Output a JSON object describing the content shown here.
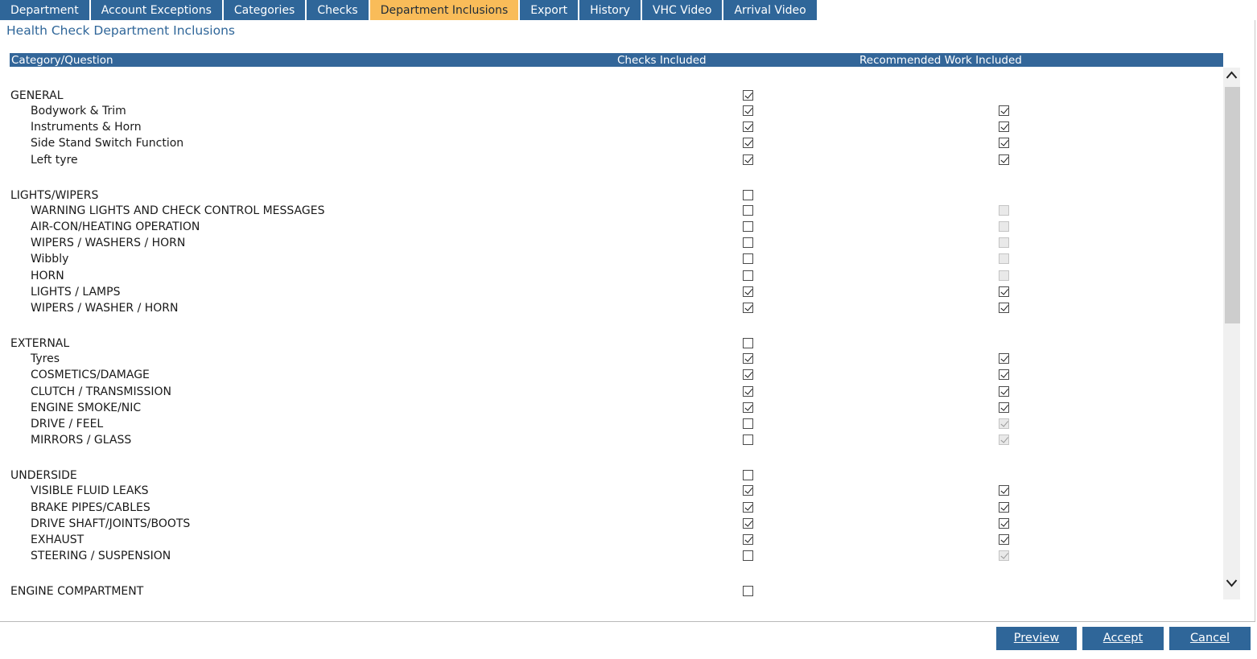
{
  "tabs": [
    {
      "label": "Department",
      "active": false
    },
    {
      "label": "Account Exceptions",
      "active": false
    },
    {
      "label": "Categories",
      "active": false
    },
    {
      "label": "Checks",
      "active": false
    },
    {
      "label": "Department Inclusions",
      "active": true
    },
    {
      "label": "Export",
      "active": false
    },
    {
      "label": "History",
      "active": false
    },
    {
      "label": "VHC Video",
      "active": false
    },
    {
      "label": "Arrival Video",
      "active": false
    }
  ],
  "page_title": "Health Check Department Inclusions",
  "grid": {
    "col_category": "Category/Question",
    "col_checks": "Checks Included",
    "col_recommended": "Recommended Work Included",
    "rows": [
      {
        "type": "group",
        "label": "GENERAL",
        "checks": true
      },
      {
        "type": "item",
        "label": "Bodywork & Trim",
        "checks": true,
        "rec": true,
        "rec_disabled": false
      },
      {
        "type": "item",
        "label": "Instruments & Horn",
        "checks": true,
        "rec": true,
        "rec_disabled": false
      },
      {
        "type": "item",
        "label": "Side Stand Switch Function",
        "checks": true,
        "rec": true,
        "rec_disabled": false
      },
      {
        "type": "item",
        "label": "Left tyre",
        "checks": true,
        "rec": true,
        "rec_disabled": false
      },
      {
        "type": "group",
        "label": "LIGHTS/WIPERS",
        "checks": false
      },
      {
        "type": "item",
        "label": "WARNING LIGHTS AND CHECK CONTROL MESSAGES",
        "checks": false,
        "rec": false,
        "rec_disabled": true
      },
      {
        "type": "item",
        "label": "AIR-CON/HEATING OPERATION",
        "checks": false,
        "rec": false,
        "rec_disabled": true
      },
      {
        "type": "item",
        "label": "WIPERS / WASHERS / HORN",
        "checks": false,
        "rec": false,
        "rec_disabled": true
      },
      {
        "type": "item",
        "label": "Wibbly",
        "checks": false,
        "rec": false,
        "rec_disabled": true
      },
      {
        "type": "item",
        "label": "HORN",
        "checks": false,
        "rec": false,
        "rec_disabled": true
      },
      {
        "type": "item",
        "label": "LIGHTS / LAMPS",
        "checks": true,
        "rec": true,
        "rec_disabled": false
      },
      {
        "type": "item",
        "label": "WIPERS / WASHER / HORN",
        "checks": true,
        "rec": true,
        "rec_disabled": false
      },
      {
        "type": "group",
        "label": "EXTERNAL",
        "checks": false
      },
      {
        "type": "item",
        "label": "Tyres",
        "checks": true,
        "rec": true,
        "rec_disabled": false
      },
      {
        "type": "item",
        "label": "COSMETICS/DAMAGE",
        "checks": true,
        "rec": true,
        "rec_disabled": false
      },
      {
        "type": "item",
        "label": "CLUTCH / TRANSMISSION",
        "checks": true,
        "rec": true,
        "rec_disabled": false
      },
      {
        "type": "item",
        "label": "ENGINE SMOKE/NIC",
        "checks": true,
        "rec": true,
        "rec_disabled": false
      },
      {
        "type": "item",
        "label": "DRIVE / FEEL",
        "checks": false,
        "rec": true,
        "rec_disabled": true
      },
      {
        "type": "item",
        "label": "MIRRORS / GLASS",
        "checks": false,
        "rec": true,
        "rec_disabled": true
      },
      {
        "type": "group",
        "label": "UNDERSIDE",
        "checks": false
      },
      {
        "type": "item",
        "label": "VISIBLE FLUID LEAKS",
        "checks": true,
        "rec": true,
        "rec_disabled": false
      },
      {
        "type": "item",
        "label": "BRAKE PIPES/CABLES",
        "checks": true,
        "rec": true,
        "rec_disabled": false
      },
      {
        "type": "item",
        "label": "DRIVE SHAFT/JOINTS/BOOTS",
        "checks": true,
        "rec": true,
        "rec_disabled": false
      },
      {
        "type": "item",
        "label": "EXHAUST",
        "checks": true,
        "rec": true,
        "rec_disabled": false
      },
      {
        "type": "item",
        "label": "STEERING / SUSPENSION",
        "checks": false,
        "rec": true,
        "rec_disabled": true
      },
      {
        "type": "group",
        "label": "ENGINE COMPARTMENT",
        "checks": false
      }
    ]
  },
  "buttons": {
    "preview": "Preview",
    "accept": "Accept",
    "cancel": "Cancel"
  },
  "icons": {
    "scroll_up": "chevron-up-icon",
    "scroll_down": "chevron-down-icon"
  },
  "colors": {
    "tab_bg": "#2f6699",
    "tab_active_bg": "#f9bc59",
    "header_bg": "#336699",
    "button_bg": "#2f6699"
  }
}
